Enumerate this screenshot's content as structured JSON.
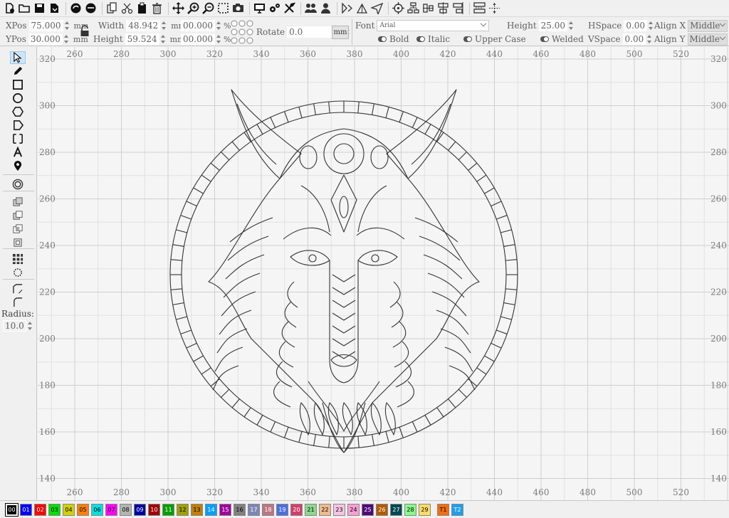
{
  "toolbar": {
    "groups": [
      [
        "new-file-icon",
        "open-folder-icon",
        "save-icon",
        "save-as-icon"
      ],
      [
        "import-icon",
        "export-icon"
      ],
      [
        "copy-icon",
        "cut-icon",
        "paste-icon",
        "delete-icon"
      ],
      [
        "move-icon",
        "zoom-in-icon",
        "zoom-out-icon",
        "zoom-fit-icon",
        "camera-icon"
      ],
      [
        "monitor-icon",
        "settings-icon",
        "tools-icon"
      ],
      [
        "users-icon",
        "user-icon"
      ],
      [
        "mirror-h-icon",
        "mirror-v-icon",
        "send-icon"
      ],
      [
        "target-icon",
        "align-tree-icon",
        "align-mid-icon",
        "align-center-icon",
        "align-right-icon"
      ],
      [
        "distribute-h-icon",
        "distribute-v-icon"
      ]
    ]
  },
  "props": {
    "xpos_label": "XPos",
    "xpos_value": "75.000",
    "ypos_label": "YPos",
    "ypos_value": "30.000",
    "unit_mm": "mm",
    "width_label": "Width",
    "width_value": "48.942",
    "height_label": "Height",
    "height_value": "59.524",
    "scale_w_value": "00.000",
    "scale_h_value": "00.000",
    "percent": "%",
    "rotate_label": "Rotate",
    "rotate_value": "0.0",
    "mm_button": "mm",
    "font_label": "Font",
    "font_value": "Arial",
    "bold_label": "Bold",
    "italic_label": "Italic",
    "uppercase_label": "Upper Case",
    "text_height_label": "Height",
    "text_height_value": "25.00",
    "welded_label": "Welded",
    "hspace_label": "HSpace",
    "hspace_value": "0.00",
    "vspace_label": "VSpace",
    "vspace_value": "0.00",
    "alignx_label": "Align X",
    "alignx_value": "Middle",
    "aligny_label": "Align Y",
    "aligny_value": "Middle"
  },
  "left_tools": [
    {
      "name": "select-icon",
      "active": true
    },
    {
      "name": "pen-icon"
    },
    {
      "name": "rectangle-icon"
    },
    {
      "name": "circle-icon"
    },
    {
      "name": "polygon-icon"
    },
    {
      "name": "pentagon-icon"
    },
    {
      "name": "frame-icon"
    },
    {
      "name": "text-icon"
    },
    {
      "name": "pin-icon"
    },
    {
      "name": "offset-icon"
    },
    {
      "name": "union-icon"
    },
    {
      "name": "subtract-icon"
    },
    {
      "name": "intersect-icon"
    },
    {
      "name": "difference-icon"
    },
    {
      "name": "array-icon"
    },
    {
      "name": "circular-array-icon"
    },
    {
      "name": "corner-icon"
    },
    {
      "name": "round-corner-icon"
    }
  ],
  "radius": {
    "label": "Radius:",
    "value": "10.0"
  },
  "canvas": {
    "x_ticks": [
      "260",
      "280",
      "300",
      "320",
      "340",
      "360",
      "380",
      "400",
      "420",
      "440",
      "460",
      "480",
      "500",
      "520"
    ],
    "y_ticks": [
      "320",
      "300",
      "280",
      "260",
      "240",
      "220",
      "200",
      "180",
      "160",
      "140"
    ]
  },
  "palette": [
    {
      "label": "00",
      "color": "#000000",
      "text": "#ffffff",
      "selected": true
    },
    {
      "label": "01",
      "color": "#0000ff",
      "text": "#ffffff"
    },
    {
      "label": "02",
      "color": "#ff0000",
      "text": "#ffffff"
    },
    {
      "label": "03",
      "color": "#00e000",
      "text": "#000000"
    },
    {
      "label": "04",
      "color": "#d0d000",
      "text": "#000000"
    },
    {
      "label": "05",
      "color": "#ff8000",
      "text": "#000000"
    },
    {
      "label": "06",
      "color": "#00e0e0",
      "text": "#000000"
    },
    {
      "label": "07",
      "color": "#ff00ff",
      "text": "#000000"
    },
    {
      "label": "08",
      "color": "#b4b4b4",
      "text": "#000000"
    },
    {
      "label": "09",
      "color": "#0000a0",
      "text": "#ffffff"
    },
    {
      "label": "10",
      "color": "#a00000",
      "text": "#ffffff"
    },
    {
      "label": "11",
      "color": "#00a000",
      "text": "#ffffff"
    },
    {
      "label": "12",
      "color": "#a0a000",
      "text": "#000000"
    },
    {
      "label": "13",
      "color": "#c08000",
      "text": "#000000"
    },
    {
      "label": "14",
      "color": "#00a0ff",
      "text": "#ffffff"
    },
    {
      "label": "15",
      "color": "#a000a0",
      "text": "#ffffff"
    },
    {
      "label": "16",
      "color": "#808080",
      "text": "#000000"
    },
    {
      "label": "17",
      "color": "#7d87b9",
      "text": "#ffffff"
    },
    {
      "label": "18",
      "color": "#bb7784",
      "text": "#ffffff"
    },
    {
      "label": "19",
      "color": "#4a6fe3",
      "text": "#ffffff"
    },
    {
      "label": "20",
      "color": "#d33f6a",
      "text": "#ffffff"
    },
    {
      "label": "21",
      "color": "#8cd78c",
      "text": "#000000"
    },
    {
      "label": "22",
      "color": "#f0b98d",
      "text": "#000000"
    },
    {
      "label": "23",
      "color": "#f6c4e1",
      "text": "#000000"
    },
    {
      "label": "24",
      "color": "#fa9ed4",
      "text": "#000000"
    },
    {
      "label": "25",
      "color": "#500a78",
      "text": "#ffffff"
    },
    {
      "label": "26",
      "color": "#b45a00",
      "text": "#ffffff"
    },
    {
      "label": "27",
      "color": "#004754",
      "text": "#ffffff"
    },
    {
      "label": "28",
      "color": "#86fa88",
      "text": "#000000"
    },
    {
      "label": "29",
      "color": "#ffdb66",
      "text": "#000000"
    },
    {
      "label": "T1",
      "color": "#f36d0d",
      "text": "#000000",
      "gap_before": true
    },
    {
      "label": "T2",
      "color": "#1d9ff0",
      "text": "#ffffff"
    }
  ]
}
